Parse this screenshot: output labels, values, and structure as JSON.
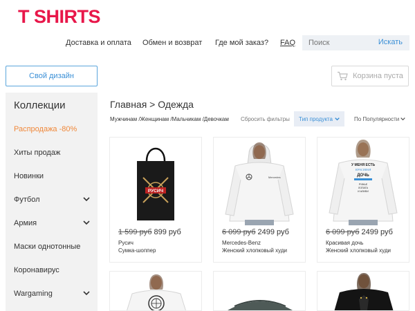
{
  "logo": "T SHIRTS",
  "nav": {
    "delivery": "Доставка и оплата",
    "exchange": "Обмен и возврат",
    "where": "Где мой заказ?",
    "faq": "FAQ"
  },
  "search": {
    "placeholder": "Поиск",
    "button": "Искать"
  },
  "design_button": "Свой дизайн",
  "cart": "Корзина пуста",
  "sidebar": {
    "title": "Коллекции",
    "items": [
      {
        "label": "Распродажа -80%",
        "expandable": false
      },
      {
        "label": "Хиты продаж",
        "expandable": false
      },
      {
        "label": "Новинки",
        "expandable": false
      },
      {
        "label": "Футбол",
        "expandable": true
      },
      {
        "label": "Армия",
        "expandable": true
      },
      {
        "label": "Маски однотонные",
        "expandable": false
      },
      {
        "label": "Коронавирус",
        "expandable": false
      },
      {
        "label": "Wargaming",
        "expandable": true
      }
    ]
  },
  "breadcrumb": "Главная > Одежда",
  "filters": "Мужчинам /Женщинам /Мальчикам /Девочкам",
  "reset_filters": "Сбросить фильтры",
  "product_type": "Тип продукта",
  "sort": "По Популярности",
  "products": [
    {
      "old_price": "1 599 руб",
      "price": "899 руб",
      "name": "Русич",
      "type": "Сумка-шоппер"
    },
    {
      "old_price": "6 099 руб",
      "price": "2499 руб",
      "name": "Mercedes-Benz",
      "type": "Женский хлопковый худи"
    },
    {
      "old_price": "6 099 руб",
      "price": "2499 руб",
      "name": "Красивая дочь",
      "type": "Женский хлопковый худи"
    }
  ],
  "hoodie_text": {
    "brand": "Mercedes",
    "slogan": [
      "У МЕНЯ ЕСТЬ",
      "КРАСИВАЯ",
      "ДОЧЬ",
      "РУЖЬЕ",
      "ЛОПАТА",
      "И АЛИБИ"
    ]
  },
  "bag_text": "РУСИЧ",
  "colors": {
    "accent": "#3a8fd6",
    "logo": "#e8174a",
    "sale": "#f0883a"
  }
}
